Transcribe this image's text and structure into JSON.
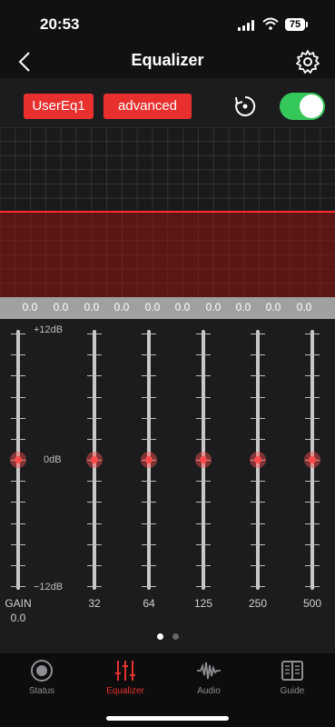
{
  "status_bar": {
    "time": "20:53",
    "battery": "75"
  },
  "nav": {
    "title": "Equalizer"
  },
  "controls": {
    "preset_label": "UserEq1",
    "mode_label": "advanced",
    "enabled": true
  },
  "band_values": [
    "0.0",
    "0.0",
    "0.0",
    "0.0",
    "0.0",
    "0.0",
    "0.0",
    "0.0",
    "0.0",
    "0.0"
  ],
  "sliders": {
    "scale": {
      "top": "+12dB",
      "mid": "0dB",
      "bottom": "−12dB"
    },
    "bands": [
      {
        "label": "GAIN",
        "value": "0.0"
      },
      {
        "label": "32"
      },
      {
        "label": "64"
      },
      {
        "label": "125"
      },
      {
        "label": "250"
      },
      {
        "label": "500"
      }
    ],
    "page": {
      "current": 1,
      "total": 2
    }
  },
  "tabs": [
    {
      "label": "Status",
      "icon": "status-icon"
    },
    {
      "label": "Equalizer",
      "icon": "equalizer-icon"
    },
    {
      "label": "Audio",
      "icon": "audio-waveform-icon"
    },
    {
      "label": "Guide",
      "icon": "book-icon"
    }
  ],
  "colors": {
    "accent": "#e8302f",
    "toggle_on": "#34c759",
    "thumb": "#ff4a4a"
  }
}
